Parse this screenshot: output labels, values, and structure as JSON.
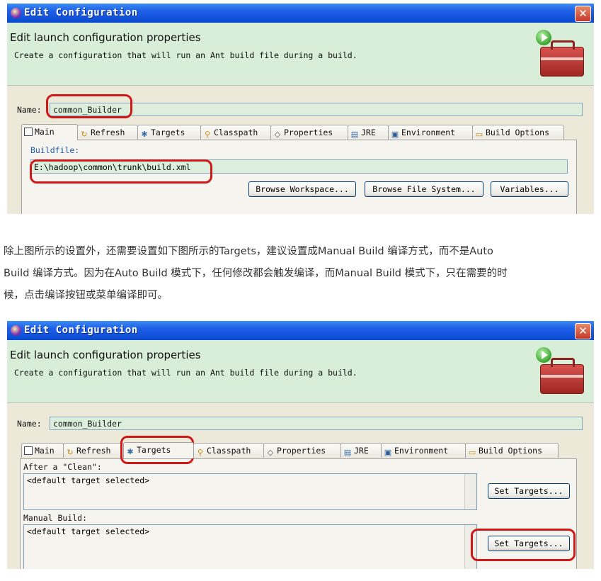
{
  "dialog1": {
    "title": "Edit Configuration",
    "header_title": "Edit launch configuration properties",
    "header_subtitle": "Create a configuration that will run an Ant build file during a build.",
    "name_label": "Name:",
    "name_value": "common_Builder",
    "tabs": [
      "Main",
      "Refresh",
      "Targets",
      "Classpath",
      "Properties",
      "JRE",
      "Environment",
      "Build Options"
    ],
    "buildfile_label": "Buildfile:",
    "buildfile_value": "E:\\hadoop\\common\\trunk\\build.xml",
    "buttons": [
      "Browse Workspace...",
      "Browse File System...",
      "Variables..."
    ]
  },
  "paragraph": {
    "line1": "除上图所示的设置外，还需要设置如下图所示的Targets，建议设置成Manual Build 编译方式，而不是Auto",
    "line2": "Build 编译方式。因为在Auto Build 模式下，任何修改都会触发编译，而Manual Build 模式下，只在需要的时",
    "line3": "候，点击编译按钮或菜单编译即可。"
  },
  "dialog2": {
    "title": "Edit Configuration",
    "header_title": "Edit launch configuration properties",
    "header_subtitle": "Create a configuration that will run an Ant build file during a build.",
    "name_label": "Name:",
    "name_value": "common_Builder",
    "tabs": [
      "Main",
      "Refresh",
      "Targets",
      "Classpath",
      "Properties",
      "JRE",
      "Environment",
      "Build Options"
    ],
    "after_clean_label": "After a \"Clean\":",
    "after_clean_value": "<default target selected>",
    "manual_build_label": "Manual Build:",
    "manual_build_value": "<default target selected>",
    "set_targets_label": "Set Targets..."
  }
}
